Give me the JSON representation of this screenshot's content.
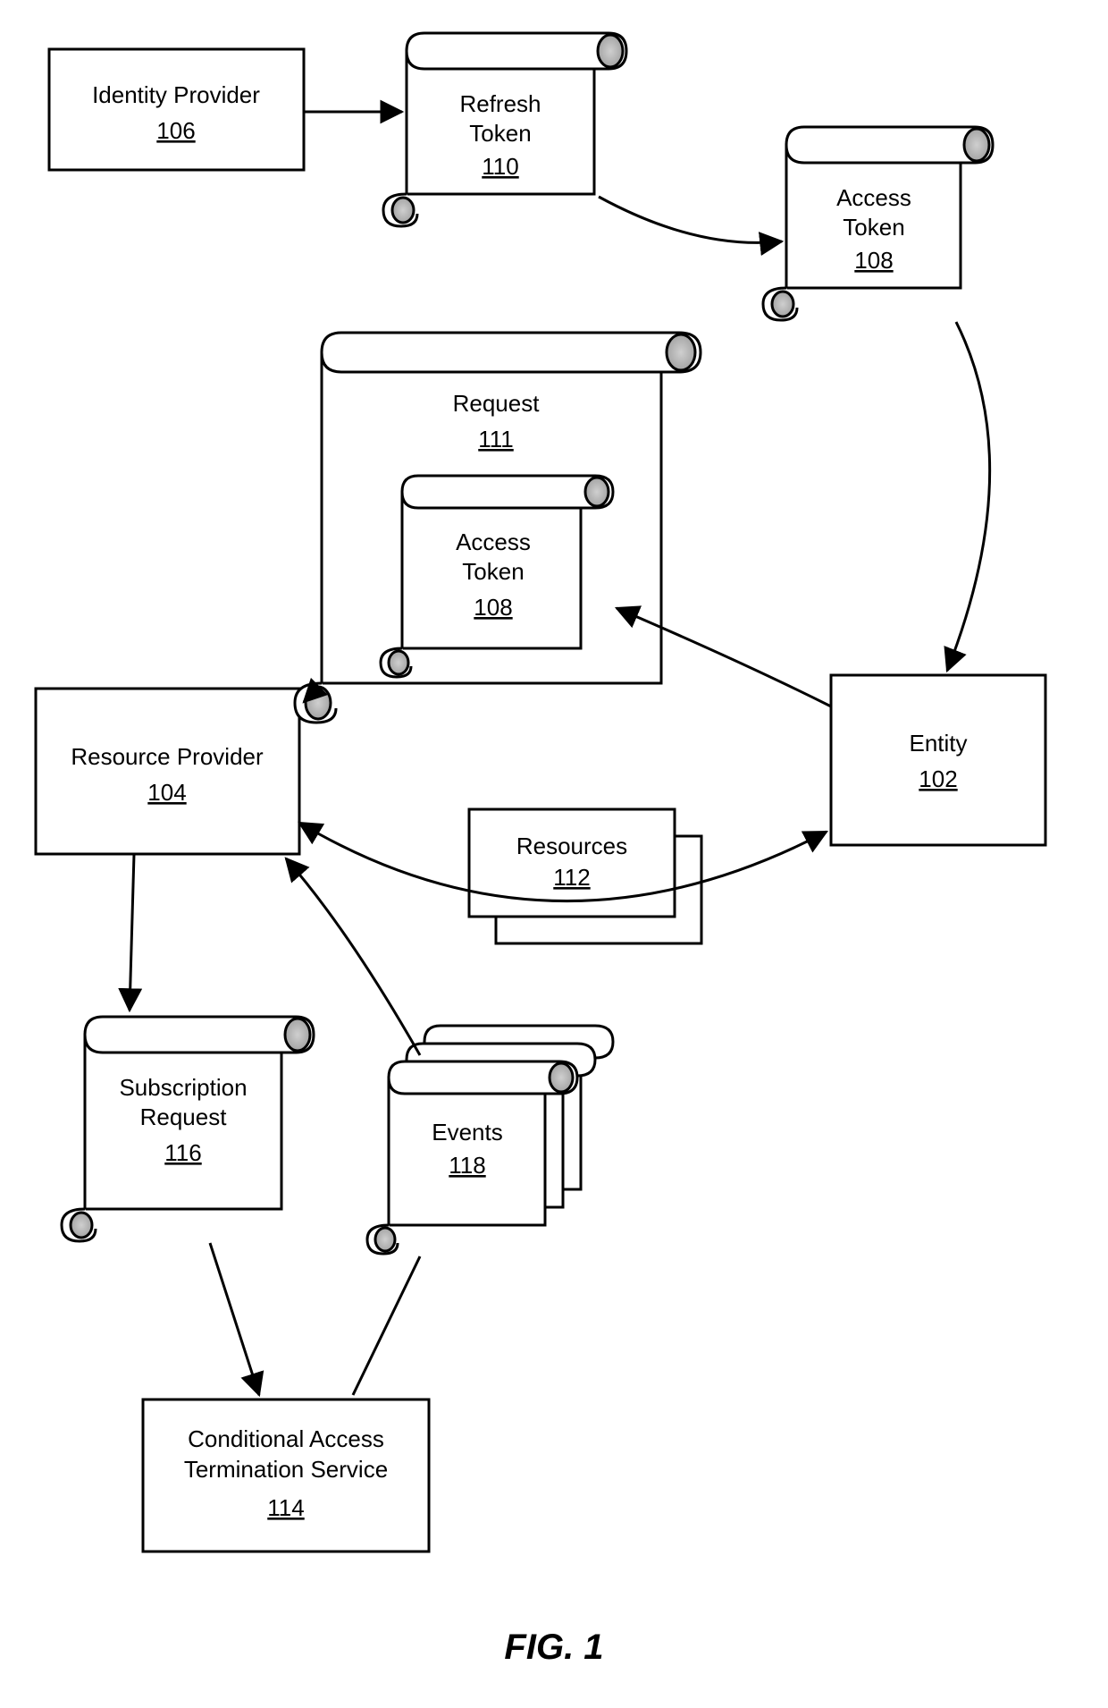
{
  "figure_label": "FIG. 1",
  "nodes": {
    "identity_provider": {
      "label": "Identity Provider",
      "num": "106"
    },
    "refresh_token": {
      "label": "Refresh Token",
      "num": "110"
    },
    "access_token": {
      "label": "Access Token",
      "num": "108"
    },
    "request": {
      "label": "Request",
      "num": "111"
    },
    "access_token2": {
      "label": "Access Token",
      "num": "108"
    },
    "resource_provider": {
      "label": "Resource Provider",
      "num": "104"
    },
    "entity": {
      "label": "Entity",
      "num": "102"
    },
    "resources": {
      "label": "Resources",
      "num": "112"
    },
    "subscription": {
      "label1": "Subscription",
      "label2": "Request",
      "num": "116"
    },
    "events": {
      "label": "Events",
      "num": "118"
    },
    "cats": {
      "label1": "Conditional Access",
      "label2": "Termination Service",
      "num": "114"
    }
  }
}
